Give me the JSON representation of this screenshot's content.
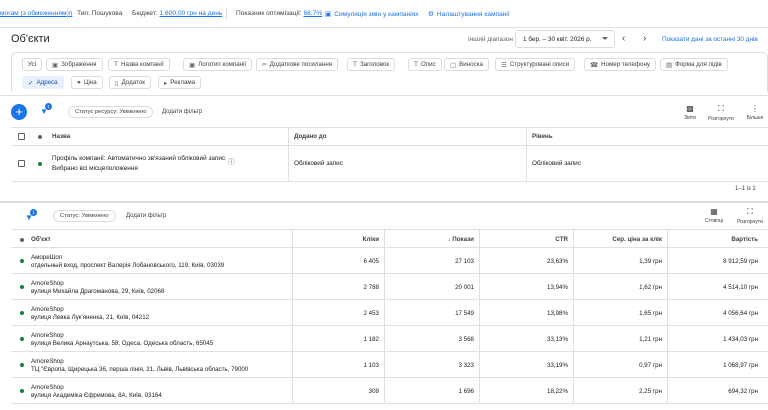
{
  "topbar": {
    "restriction": "могам (з обмеженнями)",
    "type_label": "Тип:",
    "type_value": "Пошукова",
    "budget_label": "Бюджет:",
    "budget_value": "1 600,00 грн на день",
    "optim_label": "Показник оптимізації:",
    "optim_value": "68,7%",
    "simulate": "Симуляція змін у кампаніях",
    "settings": "Налаштування кампанії"
  },
  "header": {
    "title": "Об'єкти",
    "range_label": "Інший діапазон",
    "range_value": "1 бер. – 30 квіт. 2026 р.",
    "show_last_30": "Показати дані за останні 30 днів"
  },
  "asset_chips": [
    {
      "label": "Усі",
      "icon": "",
      "selected": false
    },
    {
      "label": "Зображення",
      "icon": "image-icon",
      "selected": false
    },
    {
      "label": "Назва компанії",
      "icon": "text-icon",
      "selected": false
    },
    {
      "label": "Логотип компанії",
      "icon": "image-icon",
      "selected": false
    },
    {
      "label": "Додаткове посилання",
      "icon": "link-icon",
      "selected": false
    },
    {
      "label": "Заголовок",
      "icon": "text-icon",
      "selected": false
    },
    {
      "label": "Опис",
      "icon": "text-icon",
      "selected": false
    },
    {
      "label": "Виноска",
      "icon": "callout-icon",
      "selected": false
    },
    {
      "label": "Структуровані описи",
      "icon": "list-icon",
      "selected": false
    },
    {
      "label": "Номер телефону",
      "icon": "phone-icon",
      "selected": false
    },
    {
      "label": "Форма для лідів",
      "icon": "form-icon",
      "selected": false
    },
    {
      "label": "Адреса",
      "icon": "check-icon",
      "selected": true
    },
    {
      "label": "Ціна",
      "icon": "price-icon",
      "selected": false
    },
    {
      "label": "Додаток",
      "icon": "app-icon",
      "selected": false
    },
    {
      "label": "Реклама",
      "icon": "promo-icon",
      "selected": false
    }
  ],
  "toolbar1": {
    "filter_badge": "1",
    "status_chip": "Статус ресурсу: Увімкнено",
    "add_filter": "Додати фільтр",
    "tools": [
      "Звіти",
      "Розгорнути",
      "Більше"
    ]
  },
  "table1": {
    "headers": [
      "Назва",
      "Додано до",
      "Рівень"
    ],
    "rows": [
      {
        "name_line1": "Профіль компанії: Автоматично зв'язаний обліковий запис",
        "name_line2": "Вибрано всі місцеположення",
        "added_to": "Обліковий запис",
        "level": "Обліковий запис"
      }
    ],
    "pager": "1–1 із 1"
  },
  "toolbar2": {
    "filter_badge": "1",
    "status_chip": "Статус: Увімкнено",
    "add_filter": "Додати фільтр",
    "tools": [
      "Стовпці",
      "Розгорнути"
    ]
  },
  "table2": {
    "headers": [
      "Об'єкт",
      "Кліки",
      "Покази",
      "CTR",
      "Сер. ціна за клік",
      "Вартість"
    ],
    "sort_arrow": "↓",
    "rows": [
      {
        "name": "АмореШоп",
        "address": "отдельный вход, проспект Валерія Лобановського, 119, Київ, 03039",
        "clicks": "6 405",
        "impr": "27 103",
        "ctr": "23,63%",
        "cpc": "1,39 грн",
        "cost": "8 912,59 грн"
      },
      {
        "name": "AmoreShop",
        "address": "вулиця Михайла Драгоманова, 29, Київ, 02068",
        "clicks": "2 788",
        "impr": "20 001",
        "ctr": "13,94%",
        "cpc": "1,62 грн",
        "cost": "4 514,10 грн"
      },
      {
        "name": "AmoreShop",
        "address": "вулиця Левка Лук'яненка, 21, Київ, 04212",
        "clicks": "2 453",
        "impr": "17 549",
        "ctr": "13,98%",
        "cpc": "1,65 грн",
        "cost": "4 056,64 грн"
      },
      {
        "name": "AmoreShop",
        "address": "вулиця Велика Арнаутська, 58, Одеса, Одеська область, 65045",
        "clicks": "1 182",
        "impr": "3 568",
        "ctr": "33,13%",
        "cpc": "1,21 грн",
        "cost": "1 434,03 грн"
      },
      {
        "name": "AmoreShop",
        "address": "ТЦ \"Європа, Щирецька 36, перша лінія, 21, Львів, Львівська область, 79000",
        "clicks": "1 103",
        "impr": "3 323",
        "ctr": "33,19%",
        "cpc": "0,97 грн",
        "cost": "1 068,97 грн"
      },
      {
        "name": "AmoreShop",
        "address": "вулиця Академіка Єфремова, 8А, Київ, 03164",
        "clicks": "309",
        "impr": "1 696",
        "ctr": "18,22%",
        "cpc": "2,25 грн",
        "cost": "694,32 грн"
      }
    ]
  },
  "colors": {
    "accent": "#1a73e8",
    "enabled": "#188038",
    "chip_selected_bg": "#e8f0fe"
  }
}
